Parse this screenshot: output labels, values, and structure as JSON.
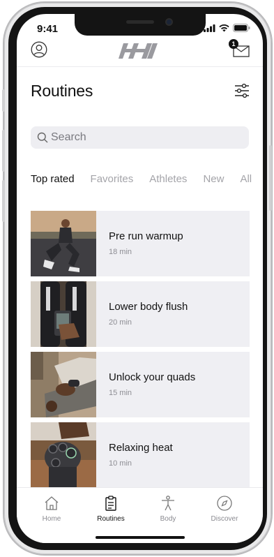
{
  "status_bar": {
    "time": "9:41"
  },
  "header": {
    "notifications_count": "1"
  },
  "page": {
    "title": "Routines"
  },
  "search": {
    "placeholder": "Search"
  },
  "tabs": [
    {
      "label": "Top rated",
      "active": true
    },
    {
      "label": "Favorites"
    },
    {
      "label": "Athletes"
    },
    {
      "label": "New"
    },
    {
      "label": "All"
    }
  ],
  "routines": [
    {
      "name": "Pre run warmup",
      "duration": "18 min"
    },
    {
      "name": "Lower body flush",
      "duration": "20 min"
    },
    {
      "name": "Unlock your quads",
      "duration": "15 min"
    },
    {
      "name": "Relaxing heat",
      "duration": "10 min"
    }
  ],
  "tabbar": [
    {
      "label": "Home",
      "icon": "home-icon"
    },
    {
      "label": "Routines",
      "icon": "routines-icon",
      "active": true
    },
    {
      "label": "Body",
      "icon": "body-icon"
    },
    {
      "label": "Discover",
      "icon": "compass-icon"
    }
  ],
  "colors": {
    "card_bg": "#efeff3",
    "text_primary": "#111111",
    "text_muted": "#a4a4a9"
  }
}
